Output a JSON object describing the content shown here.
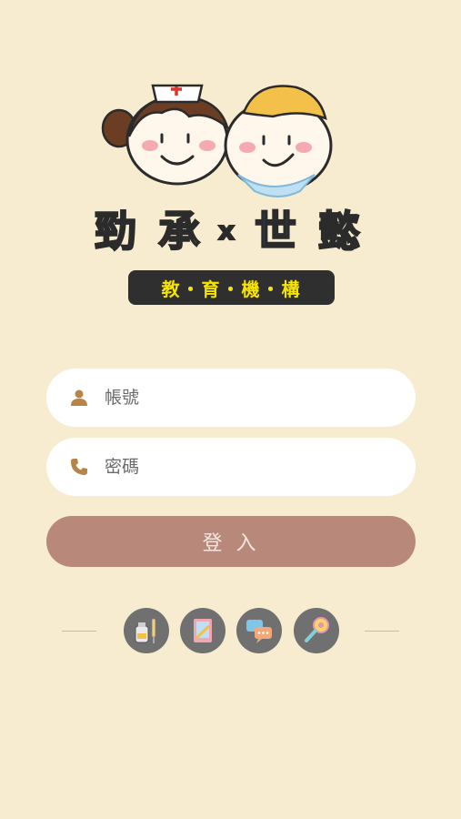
{
  "brand": {
    "chars": [
      {
        "text": "勁",
        "color": "#e0342b"
      },
      {
        "text": "承",
        "color": "#f28a1c"
      },
      {
        "text": "x",
        "color": "#2b2b2b"
      },
      {
        "text": "世",
        "color": "#3f8fd6"
      },
      {
        "text": "懿",
        "color": "#6cb33f"
      }
    ],
    "tagline": "教・育・機・構",
    "tagline_color": "#f6e400"
  },
  "login": {
    "account_placeholder": "帳號",
    "password_placeholder": "密碼",
    "submit_label": "登 入"
  },
  "shortcuts": [
    {
      "icon": "medicine-bottle-syringe-icon"
    },
    {
      "icon": "notebook-icon"
    },
    {
      "icon": "chat-bubbles-icon"
    },
    {
      "icon": "baby-rattle-icon"
    }
  ],
  "colors": {
    "background": "#f7ecd0",
    "button": "#b8897b",
    "icon_brown": "#b58446",
    "circle": "#707070"
  }
}
